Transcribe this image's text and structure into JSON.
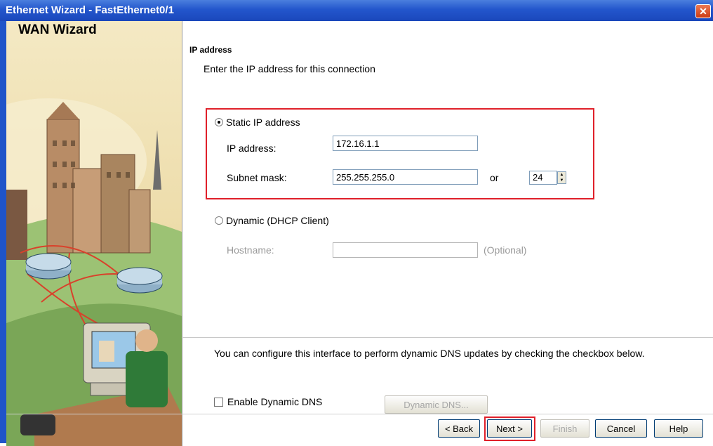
{
  "window": {
    "title": "Ethernet Wizard - FastEthernet0/1",
    "close_glyph": "✕"
  },
  "side_panel": {
    "title": "WAN Wizard",
    "illustration": "wan-network-city-illustration"
  },
  "ip_section": {
    "heading": "IP address",
    "instruction": "Enter the IP address for this connection"
  },
  "static_option": {
    "label": "Static IP address",
    "selected": true,
    "ip_label": "IP address:",
    "ip_value": "172.16.1.1",
    "mask_label": "Subnet mask:",
    "mask_value": "255.255.255.0",
    "or_label": "or",
    "prefix_value": "24"
  },
  "dynamic_option": {
    "label": "Dynamic (DHCP Client)",
    "selected": false,
    "hostname_label": "Hostname:",
    "hostname_value": "",
    "optional_label": "(Optional)"
  },
  "dns": {
    "description": "You can configure this interface to perform dynamic DNS updates by checking the checkbox below.",
    "checkbox_label": "Enable Dynamic DNS",
    "checked": false,
    "button_label": "Dynamic DNS..."
  },
  "footer": {
    "back_label": "< Back",
    "next_label": "Next >",
    "finish_label": "Finish",
    "cancel_label": "Cancel",
    "help_label": "Help"
  },
  "colors": {
    "titlebar": "#2356cc",
    "highlight": "#e0202a",
    "side_panel": "#e6cf8f"
  }
}
